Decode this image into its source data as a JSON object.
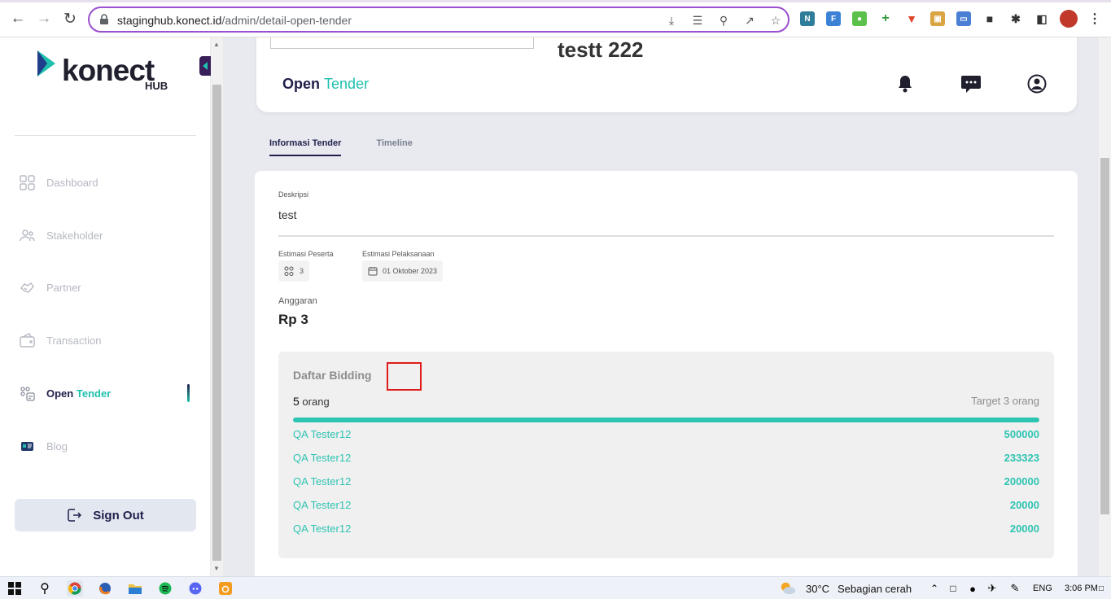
{
  "browser": {
    "url_host": "staginghub.konect.id",
    "url_path": "/admin/detail-open-tender"
  },
  "sidebar": {
    "logo_word": "konect",
    "logo_sub": "HUB",
    "items": [
      {
        "label": "Dashboard"
      },
      {
        "label": "Stakeholder"
      },
      {
        "label": "Partner"
      },
      {
        "label": "Transaction"
      },
      {
        "label_a": "Open",
        "label_b": "Tender"
      },
      {
        "label": "Blog"
      }
    ],
    "signout_label": "Sign Out"
  },
  "header": {
    "title": "testt 222",
    "sub_a": "Open",
    "sub_b": "Tender"
  },
  "tabs": [
    {
      "label": "Informasi Tender",
      "active": true
    },
    {
      "label": "Timeline",
      "active": false
    }
  ],
  "detail": {
    "desc_label": "Deskripsi",
    "desc_value": "test",
    "peserta_label": "Estimasi Peserta",
    "peserta_value": "3",
    "pelaksanaan_label": "Estimasi Pelaksanaan",
    "pelaksanaan_value": "01 Oktober 2023",
    "anggaran_label": "Anggaran",
    "anggaran_value": "Rp 3"
  },
  "bidding": {
    "title": "Daftar Bidding",
    "count_num": "5",
    "count_unit": "orang",
    "target": "Target 3 orang",
    "progress": 1.0,
    "rows": [
      {
        "name": "QA Tester12",
        "amount": "500000"
      },
      {
        "name": "QA Tester12",
        "amount": "233323"
      },
      {
        "name": "QA Tester12",
        "amount": "200000"
      },
      {
        "name": "QA Tester12",
        "amount": "20000"
      },
      {
        "name": "QA Tester12",
        "amount": "20000"
      }
    ]
  },
  "taskbar": {
    "weather_temp": "30°C",
    "weather_desc": "Sebagian cerah",
    "lang": "ENG",
    "time": "3:06 PM"
  },
  "colors": {
    "accent": "#1fc0ad",
    "navy": "#1f1f4a",
    "omnibox_border": "#9b4fd1"
  }
}
